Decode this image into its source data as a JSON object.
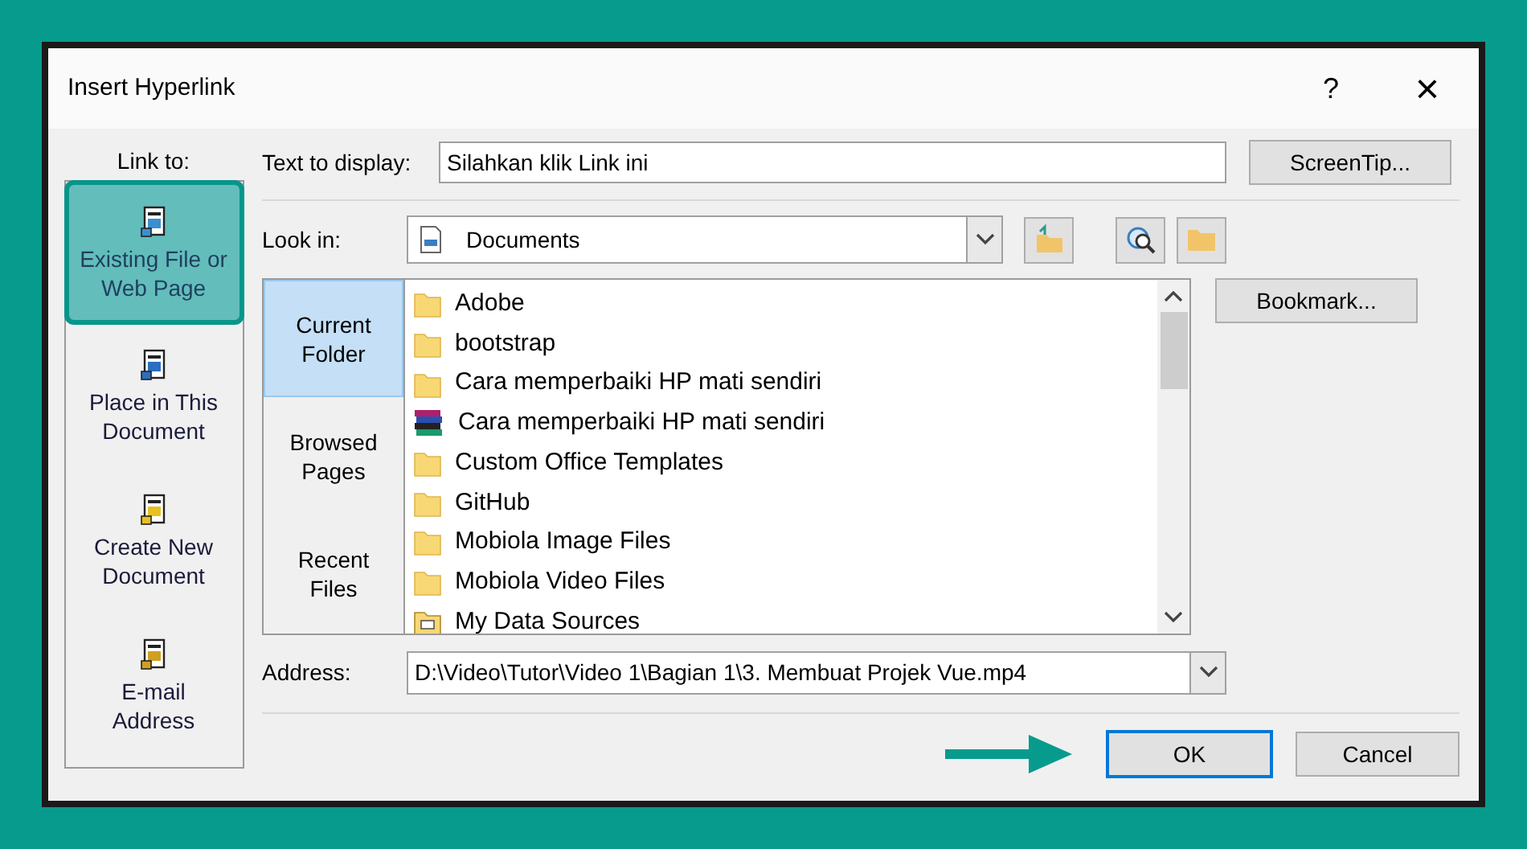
{
  "window": {
    "title": "Insert Hyperlink",
    "help": "?",
    "close": "×"
  },
  "link_to": {
    "label": "Link to:",
    "items": [
      {
        "kind": "file",
        "label": "Existing File or Web Page",
        "selected": true
      },
      {
        "kind": "place",
        "label": "Place in This Document",
        "selected": false
      },
      {
        "kind": "new",
        "label": "Create New Document",
        "selected": false
      },
      {
        "kind": "email",
        "label": "E-mail Address",
        "selected": false
      }
    ]
  },
  "text_to_display": {
    "label": "Text to display:",
    "value": "Silahkan klik Link ini"
  },
  "screentip_button": "ScreenTip...",
  "look_in": {
    "label": "Look in:",
    "value": "Documents"
  },
  "browse_tabs": [
    {
      "label": "Current Folder",
      "selected": true
    },
    {
      "label": "Browsed Pages",
      "selected": false
    },
    {
      "label": "Recent Files",
      "selected": false
    }
  ],
  "files": [
    {
      "kind": "folder",
      "name": "Adobe"
    },
    {
      "kind": "folder",
      "name": "bootstrap"
    },
    {
      "kind": "folder",
      "name": "Cara memperbaiki HP mati sendiri"
    },
    {
      "kind": "archive",
      "name": "Cara memperbaiki HP mati sendiri"
    },
    {
      "kind": "folder",
      "name": "Custom Office Templates"
    },
    {
      "kind": "folder",
      "name": "GitHub"
    },
    {
      "kind": "folder",
      "name": "Mobiola Image Files"
    },
    {
      "kind": "folder",
      "name": "Mobiola Video Files"
    },
    {
      "kind": "datasource",
      "name": "My Data Sources"
    }
  ],
  "bookmark_button": "Bookmark...",
  "address": {
    "label": "Address:",
    "value": "D:\\Video\\Tutor\\Video 1\\Bagian 1\\3. Membuat Projek Vue.mp4"
  },
  "buttons": [
    {
      "label": "OK",
      "selected": true
    },
    {
      "label": "Cancel",
      "selected": false
    }
  ]
}
